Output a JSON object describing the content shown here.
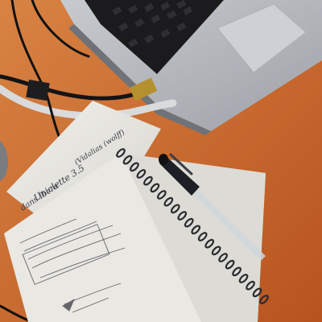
{
  "scene": {
    "description_free": true,
    "colors": {
      "desk": "#c9632a",
      "desk_light": "#d97a3e",
      "laptop": "#b9bcc1",
      "keyboard": "#1b1b1d",
      "paper": "#ecebe6",
      "ink": "#3a3a44",
      "spiral": "#2a2a2e",
      "pen_body": "#1c1f24",
      "pen_tube": "#cfd6dc"
    },
    "handwriting": {
      "top_note_line1": "dans Ibera",
      "top_note_line2": "Uniclette 3.5",
      "top_note_line3": "(Vidalias (wolff)",
      "notebook_lines": []
    }
  }
}
